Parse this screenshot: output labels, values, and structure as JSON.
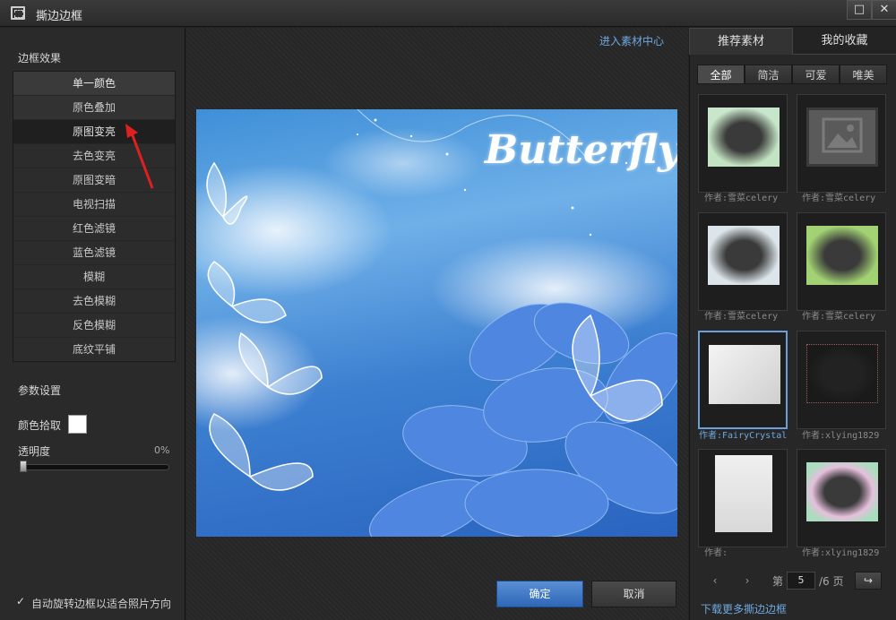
{
  "window": {
    "title": "撕边边框",
    "maximize_glyph": "□",
    "close_glyph": "✕"
  },
  "left": {
    "effects_header": "边框效果",
    "effects": [
      "单一颜色",
      "原色叠加",
      "原图变亮",
      "去色变亮",
      "原图变暗",
      "电视扫描",
      "红色滤镜",
      "蓝色滤镜",
      "模糊",
      "去色模糊",
      "反色模糊",
      "底纹平铺"
    ],
    "selected_effect_index": 0,
    "params_header": "参数设置",
    "color_pick_label": "颜色拾取",
    "color_value": "#ffffff",
    "opacity_label": "透明度",
    "opacity_value": "0%",
    "opacity_fraction": 0,
    "auto_rotate_label": "自动旋转边框以适合照片方向",
    "auto_rotate_checked": true
  },
  "center": {
    "enter_material_link": "进入素材中心",
    "preview_text": "Butterfly",
    "ok_label": "确定",
    "cancel_label": "取消"
  },
  "right": {
    "tabs": [
      "推荐素材",
      "我的收藏"
    ],
    "active_tab": 0,
    "filters": [
      "全部",
      "简洁",
      "可爱",
      "唯美"
    ],
    "active_filter": 0,
    "items": [
      {
        "author": "作者:雪菜celery"
      },
      {
        "author": "作者:雪菜celery"
      },
      {
        "author": "作者:雪菜celery"
      },
      {
        "author": "作者:雪菜celery"
      },
      {
        "author": "作者:FairyCrystal"
      },
      {
        "author": "作者:xlying1829"
      },
      {
        "author": "作者:"
      },
      {
        "author": "作者:xlying1829"
      }
    ],
    "selected_item": 4,
    "page_prefix": "第",
    "page_current": "5",
    "page_suffix": "/6 页",
    "download_more": "下载更多撕边边框"
  },
  "colors": {
    "accent": "#6fa8e0",
    "ok_button": "#3d74c4",
    "annotation_arrow": "#e02020"
  }
}
